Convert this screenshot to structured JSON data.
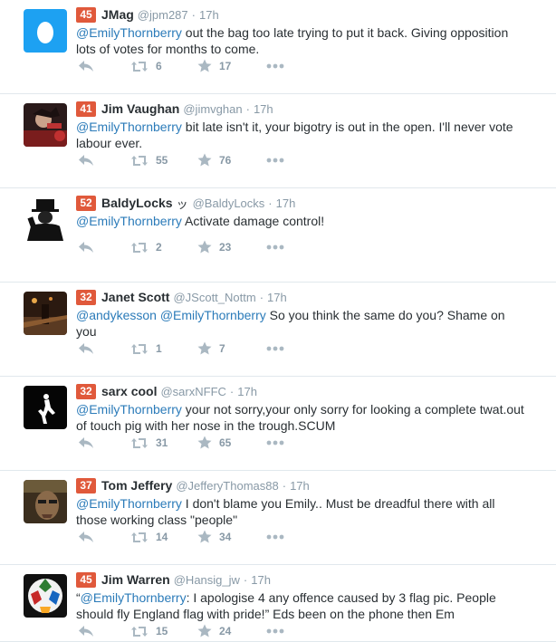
{
  "tweets": [
    {
      "badge": "45",
      "name": "JMag",
      "handle": "@jpm287",
      "separator": "·",
      "time": "17h",
      "text_parts": [
        {
          "t": "@EmilyThornberry",
          "m": true
        },
        {
          "t": " out the bag too late trying to put it back. Giving opposition lots of votes for months to come.",
          "m": false
        }
      ],
      "retweets": "6",
      "favorites": "17",
      "avatar_icon": "egg-avatar-icon"
    },
    {
      "badge": "41",
      "name": "Jim Vaughan",
      "handle": "@jimvghan",
      "separator": "·",
      "time": "17h",
      "text_parts": [
        {
          "t": "@EmilyThornberry",
          "m": true
        },
        {
          "t": " bit late isn't it, your bigotry is out in the open. I'll never vote labour ever.",
          "m": false
        }
      ],
      "retweets": "55",
      "favorites": "76",
      "avatar_icon": "user-photo-icon"
    },
    {
      "badge": "52",
      "name": "BaldyLocks",
      "name_suffix": "ッ",
      "handle": "@BaldyLocks",
      "separator": "·",
      "time": "17h",
      "text_parts": [
        {
          "t": "@EmilyThornberry",
          "m": true
        },
        {
          "t": " Activate damage control!",
          "m": false
        }
      ],
      "retweets": "2",
      "favorites": "23",
      "avatar_icon": "top-hat-avatar-icon"
    },
    {
      "badge": "32",
      "name": "Janet Scott",
      "handle": "@JScott_Nottm",
      "separator": "·",
      "time": "17h",
      "text_parts": [
        {
          "t": "@andykesson",
          "m": true
        },
        {
          "t": " ",
          "m": false
        },
        {
          "t": "@EmilyThornberry",
          "m": true
        },
        {
          "t": " So you think the same do you? Shame on you",
          "m": false
        }
      ],
      "retweets": "1",
      "favorites": "7",
      "avatar_icon": "night-street-avatar-icon"
    },
    {
      "badge": "32",
      "name": "sarx cool",
      "handle": "@sarxNFFC",
      "separator": "·",
      "time": "17h",
      "text_parts": [
        {
          "t": "@EmilyThornberry",
          "m": true
        },
        {
          "t": " your not sorry,your only sorry for looking a complete twat.out of touch pig with her nose in the trough.SCUM",
          "m": false
        }
      ],
      "retweets": "31",
      "favorites": "65",
      "avatar_icon": "figure-avatar-icon"
    },
    {
      "badge": "37",
      "name": "Tom Jeffery",
      "handle": "@JefferyThomas88",
      "separator": "·",
      "time": "17h",
      "text_parts": [
        {
          "t": "@EmilyThornberry",
          "m": true
        },
        {
          "t": " I don't blame you Emily.. Must be dreadful there with all those working class \"people\"",
          "m": false
        }
      ],
      "retweets": "14",
      "favorites": "34",
      "avatar_icon": "face-photo-avatar-icon"
    },
    {
      "badge": "45",
      "name": "Jim Warren",
      "handle": "@Hansig_jw",
      "separator": "·",
      "time": "17h",
      "text_parts": [
        {
          "t": "“",
          "m": false
        },
        {
          "t": "@EmilyThornberry",
          "m": true
        },
        {
          "t": ": I apologise 4 any offence caused by 3 flag pic. People should fly England flag with pride!” Eds been on the phone then Em",
          "m": false
        }
      ],
      "retweets": "15",
      "favorites": "24",
      "avatar_icon": "football-avatar-icon"
    }
  ],
  "colors": {
    "badge": "#e0593b",
    "mention": "#2b7bb9",
    "name": "#292f33",
    "meta": "#8899a6",
    "action": "#aab8c2",
    "divider": "#e1e8ed"
  }
}
